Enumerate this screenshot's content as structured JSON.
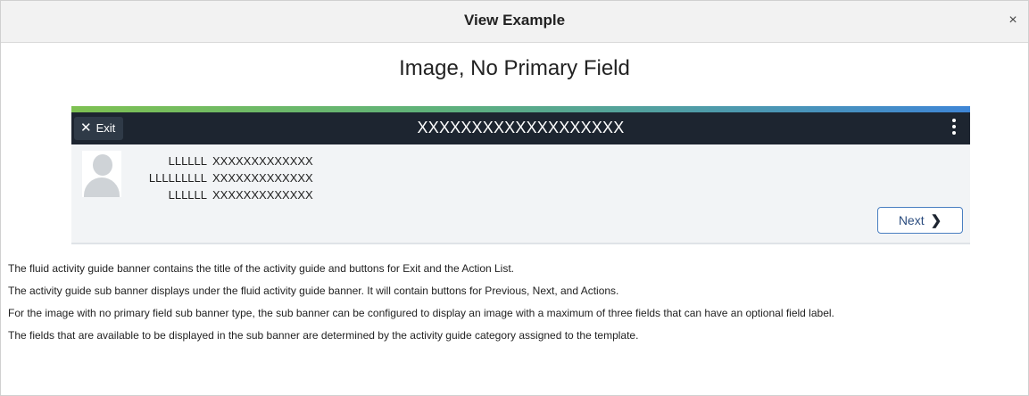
{
  "dialog": {
    "title": "View Example",
    "close_icon": "×"
  },
  "example": {
    "heading": "Image, No Primary Field"
  },
  "banner": {
    "exit_icon": "✕",
    "exit_label": "Exit",
    "title": "XXXXXXXXXXXXXXXXXXX",
    "menu_icon": "kebab-menu-icon",
    "accent_colors": [
      "#7ec152",
      "#3f86d6"
    ],
    "background": "#1d2530"
  },
  "sub_banner": {
    "fields": [
      {
        "label": "LLLLLL",
        "value": "XXXXXXXXXXXXX"
      },
      {
        "label": "LLLLLLLLL",
        "value": "XXXXXXXXXXXXX"
      },
      {
        "label": "LLLLLL",
        "value": "XXXXXXXXXXXXX"
      }
    ],
    "next_label": "Next",
    "next_icon": "❯"
  },
  "description": [
    "The fluid activity guide banner contains the title of the activity guide and buttons for Exit and the Action List.",
    "The activity guide sub banner displays under the fluid activity guide banner.  It will contain buttons for Previous, Next, and Actions.",
    "For the image with no primary field sub banner type, the sub banner can be configured to display an image with a maximum of three fields that can have an optional field label.",
    "The fields that are available to be displayed in the sub banner are determined by the activity guide category assigned to the template."
  ]
}
